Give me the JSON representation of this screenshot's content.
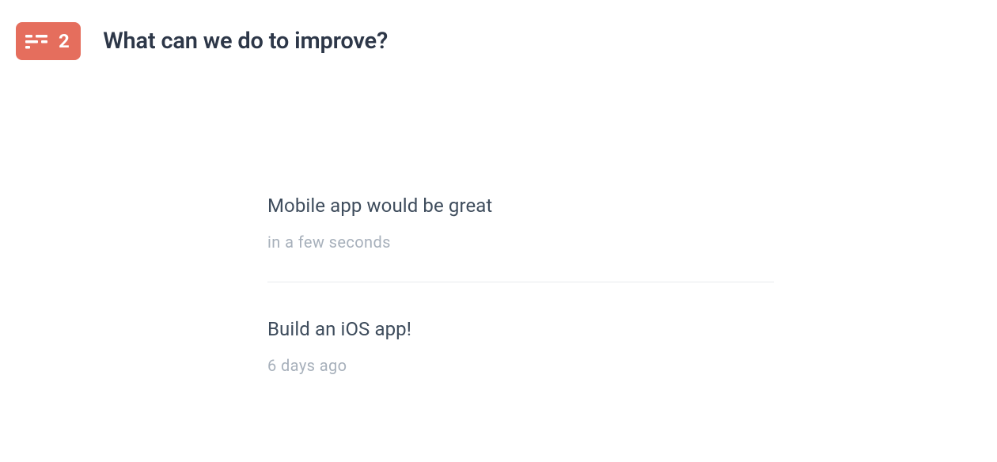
{
  "header": {
    "badge_count": "2",
    "question": "What can we do to improve?"
  },
  "responses": [
    {
      "text": "Mobile app would be great",
      "time": "in a few seconds"
    },
    {
      "text": "Build an iOS app!",
      "time": "6 days ago"
    }
  ]
}
